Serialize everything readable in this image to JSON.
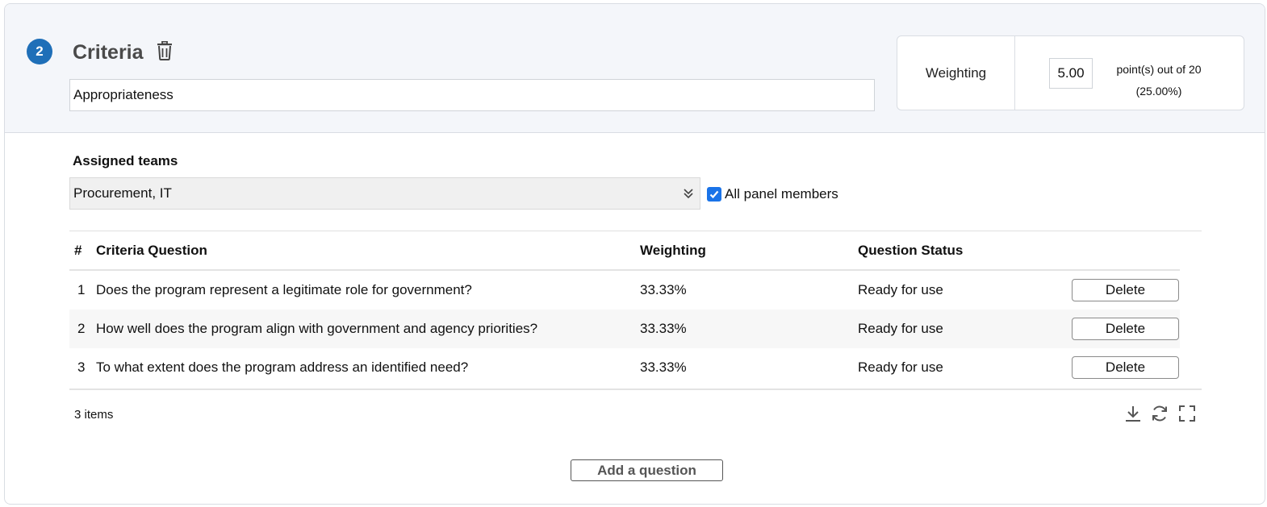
{
  "criteria": {
    "step_number": "2",
    "title": "Criteria",
    "name_value": "Appropriateness"
  },
  "weighting": {
    "label": "Weighting",
    "value": "5.00",
    "points_text": "point(s) out of 20",
    "percent_text": "(25.00%)"
  },
  "teams": {
    "label": "Assigned teams",
    "selected": "Procurement, IT",
    "all_panel_label": "All panel members",
    "all_panel_checked": true
  },
  "table": {
    "headers": [
      "#",
      "Criteria Question",
      "Weighting",
      "Question Status"
    ],
    "rows": [
      {
        "num": "1",
        "question": "Does the program represent a legitimate role for government?",
        "weighting": "33.33%",
        "status": "Ready for use",
        "action": "Delete"
      },
      {
        "num": "2",
        "question": "How well does the program align with government and agency priorities?",
        "weighting": "33.33%",
        "status": "Ready for use",
        "action": "Delete"
      },
      {
        "num": "3",
        "question": "To what extent does the program address an identified need?",
        "weighting": "33.33%",
        "status": "Ready for use",
        "action": "Delete"
      }
    ],
    "items_count": "3 items"
  },
  "actions": {
    "add_question": "Add a question"
  },
  "colors": {
    "accent": "#1f6fb8",
    "checkbox": "#1a73e8",
    "header_bg": "#f4f6fa"
  },
  "icons": {
    "delete_criteria": "trash-icon",
    "select_toggle": "chevron-double-down-icon",
    "download": "download-icon",
    "refresh": "refresh-icon",
    "fullscreen": "fullscreen-icon"
  }
}
